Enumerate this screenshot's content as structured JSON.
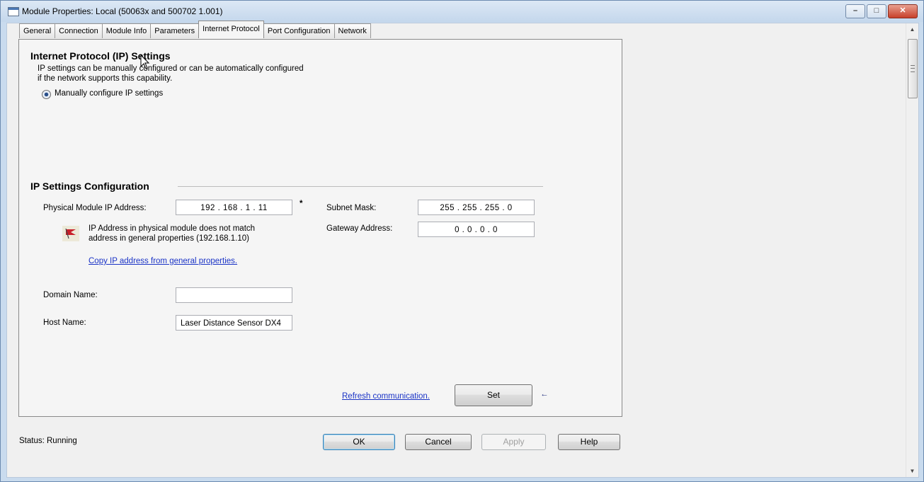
{
  "window": {
    "title": "Module Properties: Local (50063x and 500702 1.001)",
    "controls": {
      "minimize": "–",
      "maximize": "□",
      "close": "✕"
    }
  },
  "tabs": [
    {
      "label": "General"
    },
    {
      "label": "Connection"
    },
    {
      "label": "Module Info"
    },
    {
      "label": "Parameters"
    },
    {
      "label": "Internet Protocol",
      "active": true
    },
    {
      "label": "Port Configuration"
    },
    {
      "label": "Network"
    }
  ],
  "ip_settings": {
    "heading": "Internet Protocol (IP) Settings",
    "description_line1": "IP settings can be manually configured or can be automatically configured",
    "description_line2": "if the network supports this capability.",
    "manual_radio_label": "Manually configure IP settings"
  },
  "config": {
    "heading": "IP Settings Configuration",
    "physical_ip_label": "Physical Module IP Address:",
    "physical_ip_value": "192 . 168 .  1  .  11",
    "physical_ip_marker": "*",
    "subnet_label": "Subnet Mask:",
    "subnet_value": "255 . 255 . 255 .  0",
    "gateway_label": "Gateway Address:",
    "gateway_value": "0  .  0  .  0  .  0",
    "warning_line1": "IP Address in physical module does not match",
    "warning_line2": "address in general properties (192.168.1.10)",
    "copy_link": "Copy IP address from general properties.",
    "domain_label": "Domain Name:",
    "domain_value": "",
    "host_label": "Host Name:",
    "host_value": "Laser Distance Sensor DX4"
  },
  "actions": {
    "refresh_link": "Refresh communication.",
    "set_button": "Set",
    "set_arrow": "←"
  },
  "footer": {
    "status": "Status:  Running",
    "ok": "OK",
    "cancel": "Cancel",
    "apply": "Apply",
    "help": "Help"
  }
}
